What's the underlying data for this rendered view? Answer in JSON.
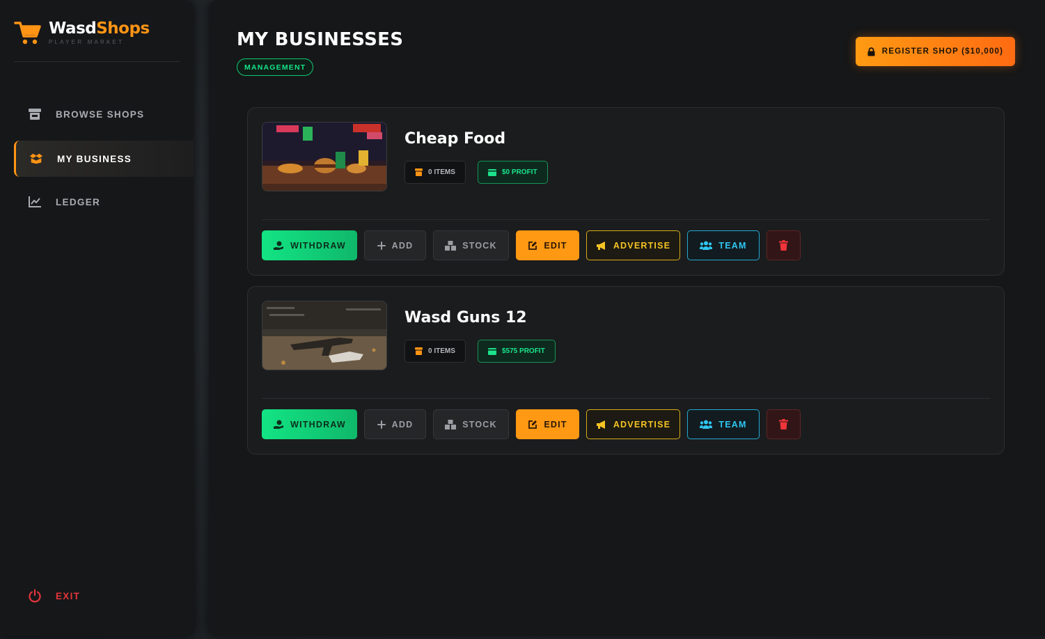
{
  "app": {
    "name_part1": "Wasd",
    "name_part2": "Shops",
    "subtitle": "PLAYER MARKET"
  },
  "colors": {
    "accent": "#ff9415",
    "success": "#12e487",
    "danger": "#e5363b",
    "info": "#2fc7f3",
    "warning": "#f5c423"
  },
  "sidebar": {
    "items": [
      {
        "label": "BROWSE SHOPS",
        "icon": "store-icon",
        "active": false
      },
      {
        "label": "MY BUSINESS",
        "icon": "box-open-icon",
        "active": true
      },
      {
        "label": "LEDGER",
        "icon": "chart-line-icon",
        "active": false
      }
    ],
    "exit_label": "EXIT"
  },
  "main": {
    "title": "MY BUSINESSES",
    "badge": "MANAGEMENT",
    "register_button": "REGISTER SHOP ($10,000)"
  },
  "shops": [
    {
      "name": "Cheap Food",
      "items": "0 ITEMS",
      "profit": "$0 PROFIT",
      "thumbnail": "food-stall-image"
    },
    {
      "name": "Wasd Guns 12",
      "items": "0 ITEMS",
      "profit": "$575 PROFIT",
      "thumbnail": "gun-workbench-image"
    }
  ],
  "actions": {
    "withdraw": "WITHDRAW",
    "add": "ADD",
    "stock": "STOCK",
    "edit": "EDIT",
    "advertise": "ADVERTISE",
    "team": "TEAM"
  }
}
